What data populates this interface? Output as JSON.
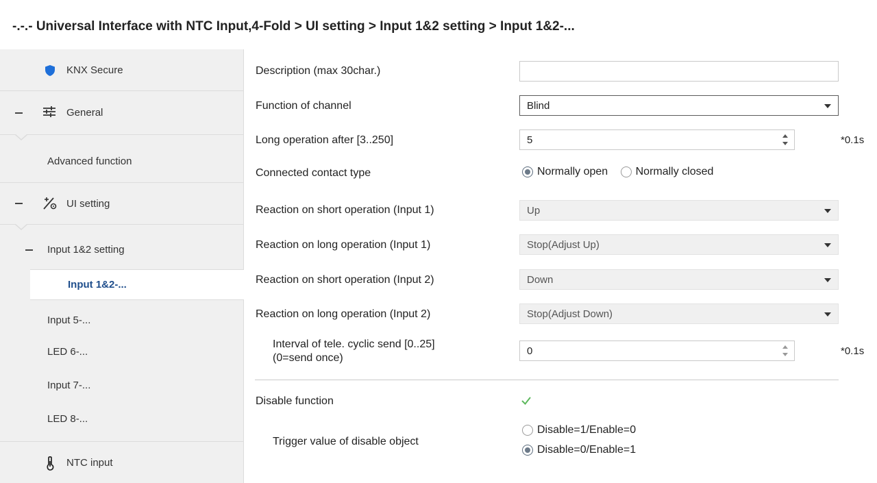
{
  "title": "-.-.- Universal Interface with NTC Input,4-Fold > UI setting > Input 1&2 setting > Input 1&2-...",
  "sidebar": {
    "knx_secure": "KNX Secure",
    "general": "General",
    "advanced_function": "Advanced function",
    "ui_setting": "UI setting",
    "input12_setting": "Input 1&2 setting",
    "input12": "Input 1&2-...",
    "input5": "Input 5-...",
    "led6": "LED 6-...",
    "input7": "Input 7-...",
    "led8": "LED 8-...",
    "ntc_input": "NTC input"
  },
  "form": {
    "description": {
      "label": "Description (max 30char.)",
      "value": ""
    },
    "function": {
      "label": "Function of channel",
      "value": "Blind"
    },
    "long_op": {
      "label": "Long operation after [3..250]",
      "value": "5",
      "unit": "*0.1s"
    },
    "contact": {
      "label": "Connected contact type",
      "opt1": "Normally open",
      "opt2": "Normally closed"
    },
    "short1": {
      "label": "Reaction on short operation (Input 1)",
      "value": "Up"
    },
    "long1": {
      "label": "Reaction on long operation (Input 1)",
      "value": "Stop(Adjust Up)"
    },
    "short2": {
      "label": "Reaction on short operation (Input 2)",
      "value": "Down"
    },
    "long2": {
      "label": "Reaction on long operation (Input 2)",
      "value": "Stop(Adjust Down)"
    },
    "interval": {
      "label_line1": "Interval of tele. cyclic send [0..25]",
      "label_line2": "(0=send once)",
      "value": "0",
      "unit": "*0.1s"
    },
    "disable": {
      "label": "Disable function",
      "checked": true
    },
    "trigger": {
      "label": "Trigger value of disable object",
      "opt1": "Disable=1/Enable=0",
      "opt2": "Disable=0/Enable=1"
    }
  },
  "colors": {
    "accent": "#1f4e8c",
    "shield": "#1e6fd9",
    "check": "#5cb85c"
  }
}
